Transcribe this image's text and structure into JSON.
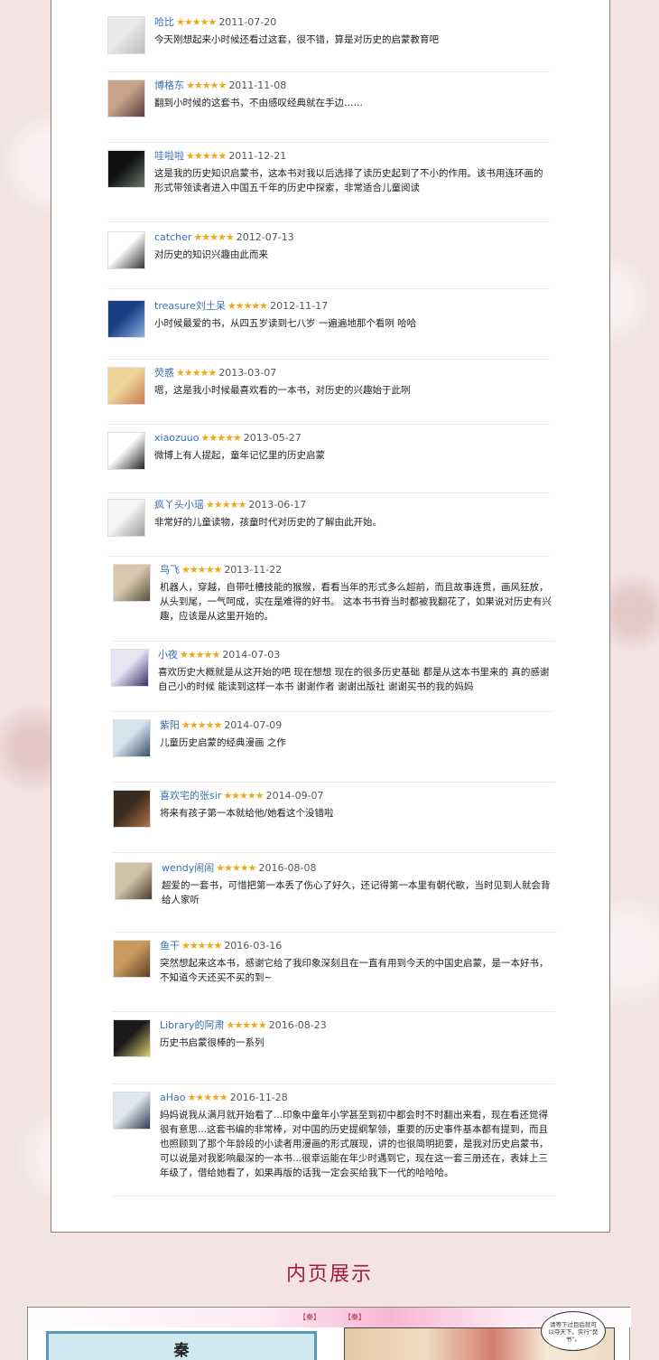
{
  "reviews": [
    {
      "user": "哈比",
      "stars": "★★★★★",
      "date": "2011-07-20",
      "text": "今天刚想起来小时候还看过这套，很不错，算是对历史的启蒙教育吧",
      "avatar_colors": [
        "#e9e9e9",
        "#bdbdbd"
      ]
    },
    {
      "user": "博格东",
      "stars": "★★★★★",
      "date": "2011-11-08",
      "text": "翻到小时候的这套书，不由感叹经典就在手边……",
      "avatar_colors": [
        "#c9a38a",
        "#5a3c3c"
      ]
    },
    {
      "user": "哇啦啦",
      "stars": "★★★★★",
      "date": "2011-12-21",
      "text": "这是我的历史知识启蒙书，这本书对我以后选择了读历史起到了不小的作用。该书用连环画的形式带领读者进入中国五千年的历史中探索，非常适合儿童阅读",
      "avatar_colors": [
        "#111111",
        "#6a7a70"
      ]
    },
    {
      "user": "catcher",
      "stars": "★★★★★",
      "date": "2012-07-13",
      "text": "对历史的知识兴趣由此而来",
      "avatar_colors": [
        "#ffffff",
        "#333333"
      ]
    },
    {
      "user": "treasure刘土呆",
      "stars": "★★★★★",
      "date": "2012-11-17",
      "text": "小时候最爱的书，从四五岁读到七八岁 一遍遍地那个看咧 哈哈",
      "avatar_colors": [
        "#1a3e86",
        "#8cb0e0"
      ]
    },
    {
      "user": "荧惑",
      "stars": "★★★★★",
      "date": "2013-03-07",
      "text": "嗯，这是我小时候最喜欢看的一本书，对历史的兴趣始于此咧",
      "avatar_colors": [
        "#f0d49a",
        "#c77a50"
      ]
    },
    {
      "user": "xiaozuuo",
      "stars": "★★★★★",
      "date": "2013-05-27",
      "text": "微博上有人提起，童年记忆里的历史启蒙",
      "avatar_colors": [
        "#ffffff",
        "#222222"
      ]
    },
    {
      "user": "疯丫头小瑶",
      "stars": "★★★★★",
      "date": "2013-06-17",
      "text": "非常好的儿童读物，孩童时代对历史的了解由此开始。",
      "avatar_colors": [
        "#f6f6f6",
        "#9a9a9a"
      ]
    },
    {
      "user": "鸟飞",
      "stars": "★★★★★",
      "date": "2013-11-22",
      "text": "机器人，穿越，自带吐槽技能的猴猴，看看当年的形式多么超前，而且故事连贯，画风狂放，从头到尾，一气呵成，实在是难得的好书。 这本书书脊当时都被我翻花了，如果说对历史有兴趣，应该是从这里开始的。",
      "avatar_colors": [
        "#d9c7b0",
        "#55503a"
      ]
    },
    {
      "user": "小夜",
      "stars": "★★★★★",
      "date": "2014-07-03",
      "text": "喜欢历史大概就是从这开始的吧 现在想想 现在的很多历史基础 都是从这本书里来的 真的感谢自己小的时候 能读到这样一本书 谢谢作者 谢谢出版社 谢谢买书的我的妈妈",
      "avatar_colors": [
        "#e8e4f4",
        "#39306a"
      ]
    },
    {
      "user": "紫阳",
      "stars": "★★★★★",
      "date": "2014-07-09",
      "text": "儿童历史启蒙的经典漫画 之作",
      "avatar_colors": [
        "#d6e4ee",
        "#3a4e66"
      ]
    },
    {
      "user": "喜欢宅的张sir",
      "stars": "★★★★★",
      "date": "2014-09-07",
      "text": "将来有孩子第一本就给他/她看这个没错啦",
      "avatar_colors": [
        "#3a2a1e",
        "#b0744a"
      ]
    },
    {
      "user": "wendy闹闹",
      "stars": "★★★★★",
      "date": "2016-08-08",
      "text": "超爱的一套书，可惜把第一本丢了伤心了好久，还记得第一本里有朝代歌，当时见到人就会背给人家听",
      "avatar_colors": [
        "#cfc4a8",
        "#4a3e2e"
      ]
    },
    {
      "user": "鱼干",
      "stars": "★★★★★",
      "date": "2016-03-16",
      "text": "突然想起来这本书，感谢它给了我印象深刻且在一直有用到今天的中国史启蒙，是一本好书，不知道今天还买不买的到~",
      "avatar_colors": [
        "#c89a5e",
        "#5e4022"
      ]
    },
    {
      "user": "Library的阿肃",
      "stars": "★★★★★",
      "date": "2016-08-23",
      "text": "历史书启蒙很棒的一系列",
      "avatar_colors": [
        "#1a1a1a",
        "#d8d070"
      ]
    },
    {
      "user": "aHao",
      "stars": "★★★★★",
      "date": "2016-11-28",
      "text": "妈妈说我从满月就开始看了...印象中童年小学甚至到初中都会时不时翻出来看，现在看还觉得很有意思...这套书编的非常棒，对中国的历史提纲挈领，重要的历史事件基本都有提到，而且也照顾到了那个年龄段的小读者用漫画的形式展现，讲的也很简明扼要，是我对历史启蒙书，可以说是对我影响最深的一本书...很幸运能在年少时遇到它，现在这一套三册还在，表妹上三年级了，借给她看了，如果再版的话我一定会买给我下一代的哈哈哈。",
      "avatar_colors": [
        "#dfe7f0",
        "#2c3a4e"
      ]
    }
  ],
  "section": {
    "title": "内页展示"
  },
  "preview": {
    "left_chip": "【秦】",
    "right_chip": "【秦】",
    "qin_label": "秦",
    "bubble_text": "请等下过目后就可以夺天下。实行“焚书”。"
  },
  "colors": {
    "accent": "#a01c3c",
    "star": "#f0a818",
    "username": "#3a70b0"
  }
}
